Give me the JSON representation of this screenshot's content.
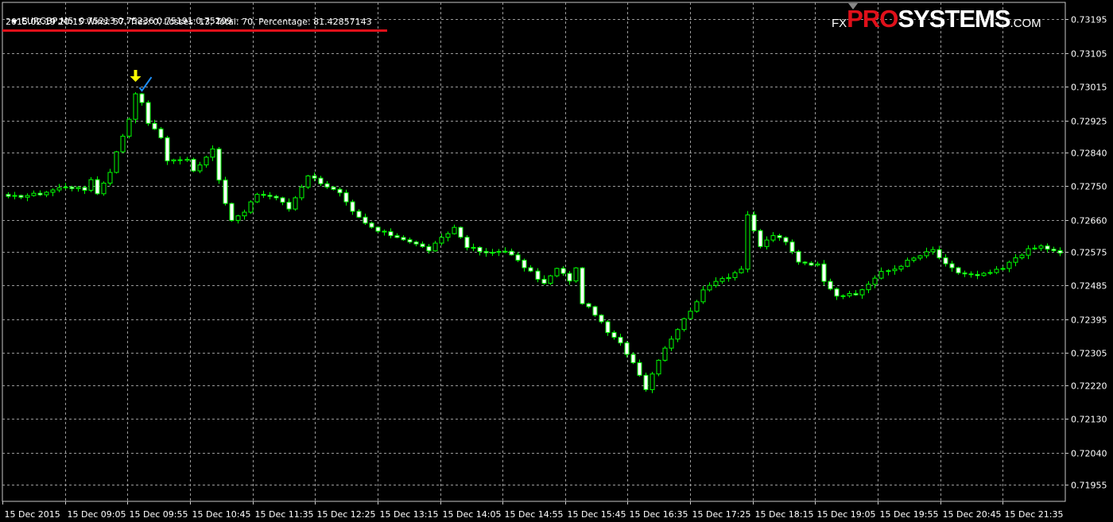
{
  "header": {
    "symbol_line": "EURGBP,M5  0.75213 0.75236 0.75191 0.75209",
    "stats_line": "2015.02.19 20:15 Wins: 57, Ties: 0, Losses: 13, Total: 70, Percentage: 81.42857143"
  },
  "logo": {
    "fx": "FX",
    "pro": "PRO",
    "systems": "SYSTEMS",
    "com": ".COM"
  },
  "colors": {
    "background": "#000000",
    "grid": "#9a9a9a",
    "candle": "#00ff00",
    "bull_body": "#000000",
    "bear_body": "#ffffff",
    "text": "#ffffff",
    "accent_red": "#e0101a",
    "signal_arrow": "#ffff00",
    "check_mark": "#1e90ff"
  },
  "icons": {
    "signal": "down-arrow-icon",
    "result": "check-mark-icon",
    "menu": "triangle-down-icon"
  },
  "chart_data": {
    "type": "candlestick",
    "symbol": "EURGBP",
    "timeframe": "M5",
    "ylim": [
      0.7191,
      0.7324
    ],
    "price_ticks": [
      "0.73195",
      "0.73105",
      "0.73015",
      "0.72925",
      "0.72840",
      "0.72750",
      "0.72660",
      "0.72575",
      "0.72485",
      "0.72395",
      "0.72305",
      "0.72220",
      "0.72130",
      "0.72040",
      "0.71955"
    ],
    "time_ticks": [
      "15 Dec 2015",
      "15 Dec 09:05",
      "15 Dec 09:55",
      "15 Dec 10:45",
      "15 Dec 11:35",
      "15 Dec 12:25",
      "15 Dec 13:15",
      "15 Dec 14:05",
      "15 Dec 14:55",
      "15 Dec 15:45",
      "15 Dec 16:35",
      "15 Dec 17:25",
      "15 Dec 18:15",
      "15 Dec 19:05",
      "15 Dec 19:55",
      "15 Dec 20:45",
      "15 Dec 21:35"
    ],
    "close_anchors": [
      [
        0,
        0.7272
      ],
      [
        5,
        0.7273
      ],
      [
        9,
        0.7275
      ],
      [
        12,
        0.7274
      ],
      [
        13,
        0.7277
      ],
      [
        14,
        0.7273
      ],
      [
        16,
        0.7279
      ],
      [
        17,
        0.7284
      ],
      [
        19,
        0.7293
      ],
      [
        20,
        0.73
      ],
      [
        21,
        0.7297
      ],
      [
        22,
        0.7292
      ],
      [
        24,
        0.7288
      ],
      [
        25,
        0.7282
      ],
      [
        28,
        0.7282
      ],
      [
        29,
        0.7279
      ],
      [
        32,
        0.7285
      ],
      [
        33,
        0.7277
      ],
      [
        34,
        0.727
      ],
      [
        35,
        0.7266
      ],
      [
        37,
        0.7268
      ],
      [
        39,
        0.7273
      ],
      [
        42,
        0.7272
      ],
      [
        44,
        0.7269
      ],
      [
        47,
        0.7278
      ],
      [
        49,
        0.7276
      ],
      [
        52,
        0.7273
      ],
      [
        54,
        0.7268
      ],
      [
        56,
        0.7265
      ],
      [
        58,
        0.7263
      ],
      [
        62,
        0.7261
      ],
      [
        66,
        0.7258
      ],
      [
        68,
        0.7261
      ],
      [
        70,
        0.7264
      ],
      [
        72,
        0.7259
      ],
      [
        75,
        0.7257
      ],
      [
        78,
        0.7258
      ],
      [
        80,
        0.7255
      ],
      [
        82,
        0.7252
      ],
      [
        84,
        0.7249
      ],
      [
        86,
        0.7253
      ],
      [
        88,
        0.725
      ],
      [
        89,
        0.7253
      ],
      [
        90,
        0.7244
      ],
      [
        92,
        0.7241
      ],
      [
        94,
        0.7236
      ],
      [
        96,
        0.7233
      ],
      [
        98,
        0.7228
      ],
      [
        99,
        0.7225
      ],
      [
        100,
        0.7221
      ],
      [
        102,
        0.7229
      ],
      [
        103,
        0.7232
      ],
      [
        105,
        0.7237
      ],
      [
        107,
        0.7242
      ],
      [
        109,
        0.7247
      ],
      [
        111,
        0.725
      ],
      [
        113,
        0.7251
      ],
      [
        115,
        0.7253
      ],
      [
        116,
        0.7267
      ],
      [
        117,
        0.7263
      ],
      [
        118,
        0.7259
      ],
      [
        120,
        0.7262
      ],
      [
        122,
        0.726
      ],
      [
        124,
        0.7255
      ],
      [
        127,
        0.7254
      ],
      [
        128,
        0.725
      ],
      [
        130,
        0.7246
      ],
      [
        133,
        0.7246
      ],
      [
        135,
        0.7249
      ],
      [
        137,
        0.7252
      ],
      [
        139,
        0.7253
      ],
      [
        141,
        0.7255
      ],
      [
        145,
        0.7258
      ],
      [
        147,
        0.7254
      ],
      [
        149,
        0.7252
      ],
      [
        152,
        0.7251
      ],
      [
        156,
        0.7253
      ],
      [
        158,
        0.7256
      ],
      [
        160,
        0.7258
      ],
      [
        162,
        0.7259
      ],
      [
        165,
        0.7257
      ]
    ],
    "markers": [
      {
        "type": "signal",
        "candle_index": 20
      },
      {
        "type": "result",
        "candle_index": 21
      }
    ]
  }
}
